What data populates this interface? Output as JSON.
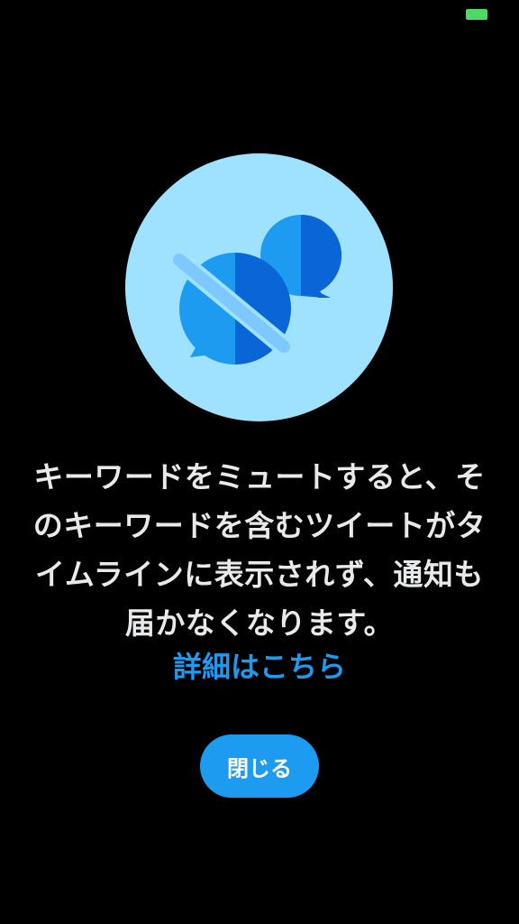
{
  "status_bar": {
    "battery_color": "#4cd964"
  },
  "illustration": {
    "icon": "muted-chat-bubbles-icon",
    "background_color": "#9ee2ff"
  },
  "dialog": {
    "message": "キーワードをミュートすると、そのキーワードを含むツイートがタイムラインに表示されず、通知も届かなくなります。",
    "learn_more_label": "詳細はこちら",
    "close_label": "閉じる"
  },
  "colors": {
    "accent": "#1d9bf0",
    "text": "#e7e9ea",
    "background": "#000000"
  }
}
